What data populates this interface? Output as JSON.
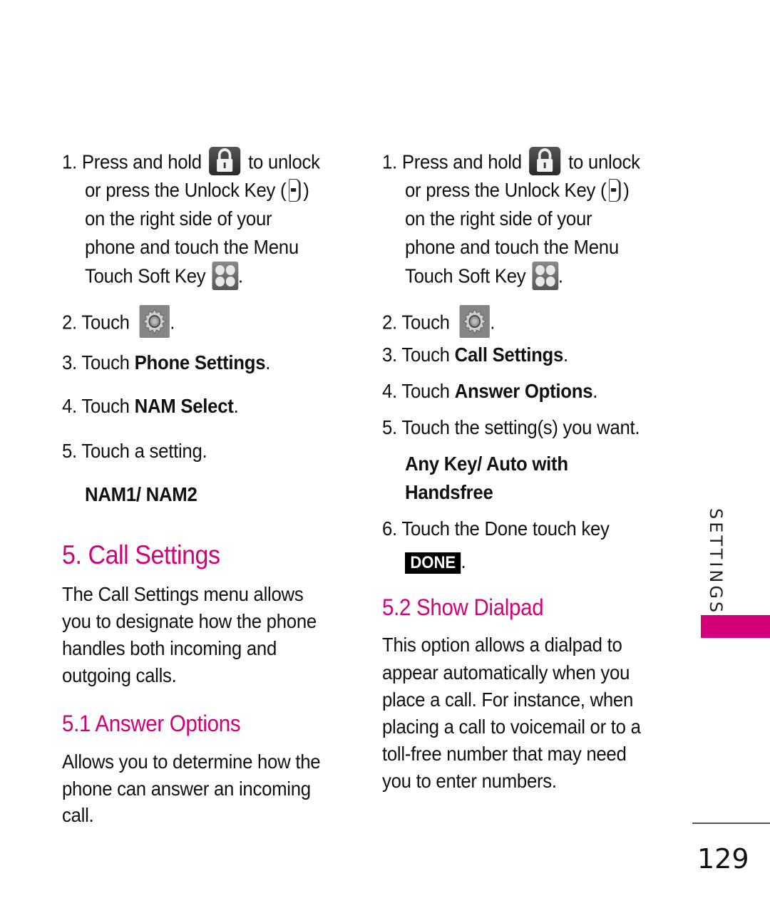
{
  "colors": {
    "accent": "#D4007A",
    "text": "#111111",
    "done_key_bg": "#000000"
  },
  "left_column": {
    "steps": [
      {
        "number": "1.",
        "lines": [
          "Press and hold",
          "to unlock",
          "or press the Unlock Key (",
          ")",
          "on the right side of your",
          "phone and touch the Menu",
          "Touch Soft Key",
          "."
        ],
        "icons": [
          "lock-icon",
          "unlock-key-icon",
          "menu-soft-key-icon"
        ]
      },
      {
        "number": "2.",
        "text": "Touch",
        "suffix": ".",
        "icon": "settings-gear-icon"
      },
      {
        "number": "3.",
        "text": "Touch",
        "bold": "Phone Settings",
        "suffix": "."
      },
      {
        "number": "4.",
        "text": "Touch",
        "bold": "NAM Select",
        "suffix": "."
      },
      {
        "number": "5.",
        "text": "Touch a setting."
      }
    ],
    "options": "NAM1/ NAM2",
    "section_title": "5. Call Settings",
    "section_body": [
      "The Call Settings menu allows",
      "you to designate how the phone",
      "handles both incoming and",
      "outgoing calls."
    ],
    "subsection_title": "5.1 Answer Options",
    "subsection_body": [
      "Allows you to determine how the",
      "phone can answer an incoming",
      "call."
    ]
  },
  "right_column": {
    "steps": [
      {
        "number": "1.",
        "lines": [
          "Press and hold",
          "to unlock",
          "or press the Unlock Key (",
          ")",
          "on the right side of your",
          "phone and touch the Menu",
          "Touch Soft Key",
          "."
        ],
        "icons": [
          "lock-icon",
          "unlock-key-icon",
          "menu-soft-key-icon"
        ]
      },
      {
        "number": "2.",
        "text": "Touch",
        "suffix": ".",
        "icon": "settings-gear-icon"
      },
      {
        "number": "3.",
        "text": "Touch",
        "bold": "Call Settings",
        "suffix": "."
      },
      {
        "number": "4.",
        "text": "Touch",
        "bold": "Answer Options",
        "suffix": "."
      },
      {
        "number": "5.",
        "text": "Touch the setting(s)  you want."
      },
      {
        "number": "6.",
        "text": "Touch the Done touch key",
        "key_label": "DONE",
        "suffix": "."
      }
    ],
    "options": [
      "Any Key/ Auto with",
      "Handsfree"
    ],
    "subsection_title": "5.2 Show Dialpad",
    "subsection_body": [
      "This option allows a dialpad to",
      "appear automatically when you",
      "place a call. For instance, when",
      "placing a call to voicemail or to a",
      "toll-free number that may need",
      "you to enter numbers."
    ]
  },
  "side_tab": {
    "label": "SETTINGS"
  },
  "page_number": "129"
}
